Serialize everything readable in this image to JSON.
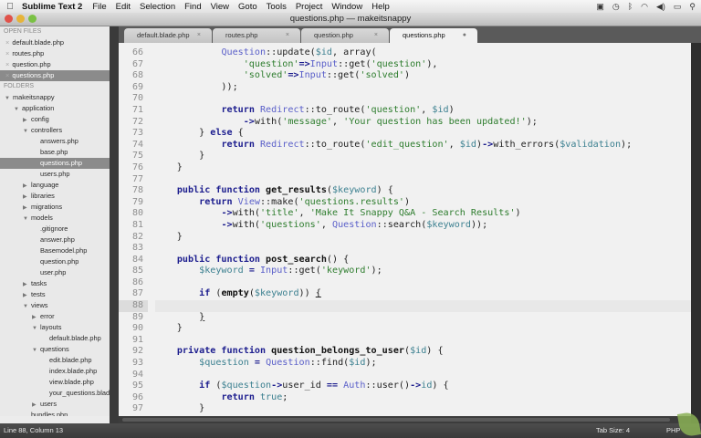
{
  "menubar": {
    "app_name": "Sublime Text 2",
    "items": [
      "File",
      "Edit",
      "Selection",
      "Find",
      "View",
      "Goto",
      "Tools",
      "Project",
      "Window",
      "Help"
    ]
  },
  "window": {
    "title": "questions.php — makeitsnappy"
  },
  "tabs": [
    {
      "label": "default.blade.php",
      "active": false
    },
    {
      "label": "routes.php",
      "active": false
    },
    {
      "label": "question.php",
      "active": false
    },
    {
      "label": "questions.php",
      "active": true
    }
  ],
  "sidebar": {
    "open_files_header": "OPEN FILES",
    "open_files": [
      {
        "label": "default.blade.php",
        "selected": false
      },
      {
        "label": "routes.php",
        "selected": false
      },
      {
        "label": "question.php",
        "selected": false
      },
      {
        "label": "questions.php",
        "selected": true
      }
    ],
    "folders_header": "FOLDERS",
    "tree": [
      {
        "label": "makeitsnappy",
        "depth": 0,
        "type": "open"
      },
      {
        "label": "application",
        "depth": 1,
        "type": "open"
      },
      {
        "label": "config",
        "depth": 2,
        "type": "closed"
      },
      {
        "label": "controllers",
        "depth": 2,
        "type": "open"
      },
      {
        "label": "answers.php",
        "depth": 3,
        "type": "file"
      },
      {
        "label": "base.php",
        "depth": 3,
        "type": "file"
      },
      {
        "label": "questions.php",
        "depth": 3,
        "type": "file",
        "selected": true
      },
      {
        "label": "users.php",
        "depth": 3,
        "type": "file"
      },
      {
        "label": "language",
        "depth": 2,
        "type": "closed"
      },
      {
        "label": "libraries",
        "depth": 2,
        "type": "closed"
      },
      {
        "label": "migrations",
        "depth": 2,
        "type": "closed"
      },
      {
        "label": "models",
        "depth": 2,
        "type": "open"
      },
      {
        "label": ".gitignore",
        "depth": 3,
        "type": "file"
      },
      {
        "label": "answer.php",
        "depth": 3,
        "type": "file"
      },
      {
        "label": "Basemodel.php",
        "depth": 3,
        "type": "file"
      },
      {
        "label": "question.php",
        "depth": 3,
        "type": "file"
      },
      {
        "label": "user.php",
        "depth": 3,
        "type": "file"
      },
      {
        "label": "tasks",
        "depth": 2,
        "type": "closed"
      },
      {
        "label": "tests",
        "depth": 2,
        "type": "closed"
      },
      {
        "label": "views",
        "depth": 2,
        "type": "open"
      },
      {
        "label": "error",
        "depth": 3,
        "type": "closed"
      },
      {
        "label": "layouts",
        "depth": 3,
        "type": "open"
      },
      {
        "label": "default.blade.php",
        "depth": 4,
        "type": "file"
      },
      {
        "label": "questions",
        "depth": 3,
        "type": "open"
      },
      {
        "label": "edit.blade.php",
        "depth": 4,
        "type": "file"
      },
      {
        "label": "index.blade.php",
        "depth": 4,
        "type": "file"
      },
      {
        "label": "view.blade.php",
        "depth": 4,
        "type": "file"
      },
      {
        "label": "your_questions.blade.php",
        "depth": 4,
        "type": "file"
      },
      {
        "label": "users",
        "depth": 3,
        "type": "closed"
      },
      {
        "label": "bundles.php",
        "depth": 2,
        "type": "file"
      }
    ]
  },
  "editor": {
    "current_line": 88,
    "lines": [
      {
        "n": 66,
        "t": [
          [
            "p",
            "            "
          ],
          [
            "c",
            "Question"
          ],
          [
            "p",
            "::update("
          ],
          [
            "v",
            "$id"
          ],
          [
            "p",
            ", array("
          ]
        ]
      },
      {
        "n": 67,
        "t": [
          [
            "p",
            "                "
          ],
          [
            "s",
            "'question'"
          ],
          [
            "o",
            "=>"
          ],
          [
            "c",
            "Input"
          ],
          [
            "p",
            "::get("
          ],
          [
            "s",
            "'question'"
          ],
          [
            "p",
            "),"
          ]
        ]
      },
      {
        "n": 68,
        "t": [
          [
            "p",
            "                "
          ],
          [
            "s",
            "'solved'"
          ],
          [
            "o",
            "=>"
          ],
          [
            "c",
            "Input"
          ],
          [
            "p",
            "::get("
          ],
          [
            "s",
            "'solved'"
          ],
          [
            "p",
            ")"
          ]
        ]
      },
      {
        "n": 69,
        "t": [
          [
            "p",
            "            ));"
          ]
        ]
      },
      {
        "n": 70,
        "t": []
      },
      {
        "n": 71,
        "t": [
          [
            "p",
            "            "
          ],
          [
            "k",
            "return"
          ],
          [
            "p",
            " "
          ],
          [
            "c",
            "Redirect"
          ],
          [
            "p",
            "::to_route("
          ],
          [
            "s",
            "'question'"
          ],
          [
            "p",
            ", "
          ],
          [
            "v",
            "$id"
          ],
          [
            "p",
            ")"
          ]
        ]
      },
      {
        "n": 72,
        "t": [
          [
            "p",
            "                "
          ],
          [
            "o",
            "->"
          ],
          [
            "p",
            "with("
          ],
          [
            "s",
            "'message'"
          ],
          [
            "p",
            ", "
          ],
          [
            "s",
            "'Your question has been updated!'"
          ],
          [
            "p",
            ");"
          ]
        ]
      },
      {
        "n": 73,
        "t": [
          [
            "p",
            "        } "
          ],
          [
            "k",
            "else"
          ],
          [
            "p",
            " {"
          ]
        ]
      },
      {
        "n": 74,
        "t": [
          [
            "p",
            "            "
          ],
          [
            "k",
            "return"
          ],
          [
            "p",
            " "
          ],
          [
            "c",
            "Redirect"
          ],
          [
            "p",
            "::to_route("
          ],
          [
            "s",
            "'edit_question'"
          ],
          [
            "p",
            ", "
          ],
          [
            "v",
            "$id"
          ],
          [
            "p",
            ")"
          ],
          [
            "o",
            "->"
          ],
          [
            "p",
            "with_errors("
          ],
          [
            "v",
            "$validation"
          ],
          [
            "p",
            ");"
          ]
        ]
      },
      {
        "n": 75,
        "t": [
          [
            "p",
            "        }"
          ]
        ]
      },
      {
        "n": 76,
        "t": [
          [
            "p",
            "    }"
          ]
        ]
      },
      {
        "n": 77,
        "t": []
      },
      {
        "n": 78,
        "t": [
          [
            "p",
            "    "
          ],
          [
            "k",
            "public function"
          ],
          [
            "p",
            " "
          ],
          [
            "f",
            "get_results"
          ],
          [
            "p",
            "("
          ],
          [
            "v",
            "$keyword"
          ],
          [
            "p",
            ") {"
          ]
        ]
      },
      {
        "n": 79,
        "t": [
          [
            "p",
            "        "
          ],
          [
            "k",
            "return"
          ],
          [
            "p",
            " "
          ],
          [
            "c",
            "View"
          ],
          [
            "p",
            "::make("
          ],
          [
            "s",
            "'questions.results'"
          ],
          [
            "p",
            ")"
          ]
        ]
      },
      {
        "n": 80,
        "t": [
          [
            "p",
            "            "
          ],
          [
            "o",
            "->"
          ],
          [
            "p",
            "with("
          ],
          [
            "s",
            "'title'"
          ],
          [
            "p",
            ", "
          ],
          [
            "s",
            "'Make It Snappy Q&A - Search Results'"
          ],
          [
            "p",
            ")"
          ]
        ]
      },
      {
        "n": 81,
        "t": [
          [
            "p",
            "            "
          ],
          [
            "o",
            "->"
          ],
          [
            "p",
            "with("
          ],
          [
            "s",
            "'questions'"
          ],
          [
            "p",
            ", "
          ],
          [
            "c",
            "Question"
          ],
          [
            "p",
            "::search("
          ],
          [
            "v",
            "$keyword"
          ],
          [
            "p",
            "));"
          ]
        ]
      },
      {
        "n": 82,
        "t": [
          [
            "p",
            "    }"
          ]
        ]
      },
      {
        "n": 83,
        "t": []
      },
      {
        "n": 84,
        "t": [
          [
            "p",
            "    "
          ],
          [
            "k",
            "public function"
          ],
          [
            "p",
            " "
          ],
          [
            "f",
            "post_search"
          ],
          [
            "p",
            "() {"
          ]
        ]
      },
      {
        "n": 85,
        "t": [
          [
            "p",
            "        "
          ],
          [
            "v",
            "$keyword"
          ],
          [
            "p",
            " "
          ],
          [
            "o",
            "="
          ],
          [
            "p",
            " "
          ],
          [
            "c",
            "Input"
          ],
          [
            "p",
            "::get("
          ],
          [
            "s",
            "'keyword'"
          ],
          [
            "p",
            ");"
          ]
        ]
      },
      {
        "n": 86,
        "t": []
      },
      {
        "n": 87,
        "t": [
          [
            "p",
            "        "
          ],
          [
            "k",
            "if"
          ],
          [
            "p",
            " ("
          ],
          [
            "f",
            "empty"
          ],
          [
            "p",
            "("
          ],
          [
            "v",
            "$keyword"
          ],
          [
            "p",
            ")) "
          ],
          [
            "u",
            "{"
          ]
        ]
      },
      {
        "n": 88,
        "t": []
      },
      {
        "n": 89,
        "t": [
          [
            "p",
            "        "
          ],
          [
            "u",
            "}"
          ]
        ]
      },
      {
        "n": 90,
        "t": [
          [
            "p",
            "    }"
          ]
        ]
      },
      {
        "n": 91,
        "t": []
      },
      {
        "n": 92,
        "t": [
          [
            "p",
            "    "
          ],
          [
            "k",
            "private function"
          ],
          [
            "p",
            " "
          ],
          [
            "f",
            "question_belongs_to_user"
          ],
          [
            "p",
            "("
          ],
          [
            "v",
            "$id"
          ],
          [
            "p",
            ") {"
          ]
        ]
      },
      {
        "n": 93,
        "t": [
          [
            "p",
            "        "
          ],
          [
            "v",
            "$question"
          ],
          [
            "p",
            " "
          ],
          [
            "o",
            "="
          ],
          [
            "p",
            " "
          ],
          [
            "c",
            "Question"
          ],
          [
            "p",
            "::find("
          ],
          [
            "v",
            "$id"
          ],
          [
            "p",
            ");"
          ]
        ]
      },
      {
        "n": 94,
        "t": []
      },
      {
        "n": 95,
        "t": [
          [
            "p",
            "        "
          ],
          [
            "k",
            "if"
          ],
          [
            "p",
            " ("
          ],
          [
            "v",
            "$question"
          ],
          [
            "o",
            "->"
          ],
          [
            "p",
            "user_id "
          ],
          [
            "o",
            "=="
          ],
          [
            "p",
            " "
          ],
          [
            "c",
            "Auth"
          ],
          [
            "p",
            "::user()"
          ],
          [
            "o",
            "->"
          ],
          [
            "v",
            "id"
          ],
          [
            "p",
            ") {"
          ]
        ]
      },
      {
        "n": 96,
        "t": [
          [
            "p",
            "            "
          ],
          [
            "k",
            "return"
          ],
          [
            "p",
            " "
          ],
          [
            "v",
            "true"
          ],
          [
            "p",
            ";"
          ]
        ]
      },
      {
        "n": 97,
        "t": [
          [
            "p",
            "        }"
          ]
        ]
      }
    ]
  },
  "statusbar": {
    "position": "Line 88, Column 13",
    "tab_size": "Tab Size: 4",
    "syntax": "PHP"
  }
}
